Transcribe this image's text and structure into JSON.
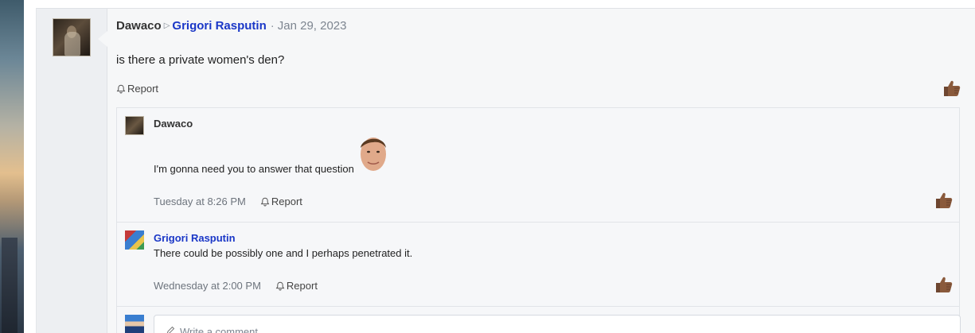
{
  "post": {
    "author": "Dawaco",
    "target": "Grigori Rasputin",
    "separator": "·",
    "date": "Jan 29, 2023",
    "message": "is there a private women's den?",
    "report_label": "Report"
  },
  "comments": [
    {
      "author": "Dawaco",
      "text": "I'm gonna need you to answer that question",
      "time": "Tuesday at 8:26 PM",
      "report_label": "Report"
    },
    {
      "author": "Grigori Rasputin",
      "text": "There could be possibly one and I perhaps penetrated it.",
      "time": "Wednesday at 2:00 PM",
      "report_label": "Report"
    }
  ],
  "comment_input": {
    "placeholder": "Write a comment..."
  },
  "icons": {
    "report": "bell-icon",
    "reaction": "thumbs-up-icon",
    "comment": "pencil-icon",
    "post_separator": "triangle-right-icon"
  },
  "colors": {
    "link": "#1a37c7",
    "muted": "#7d8590",
    "thumb": "#8a5a3c"
  }
}
